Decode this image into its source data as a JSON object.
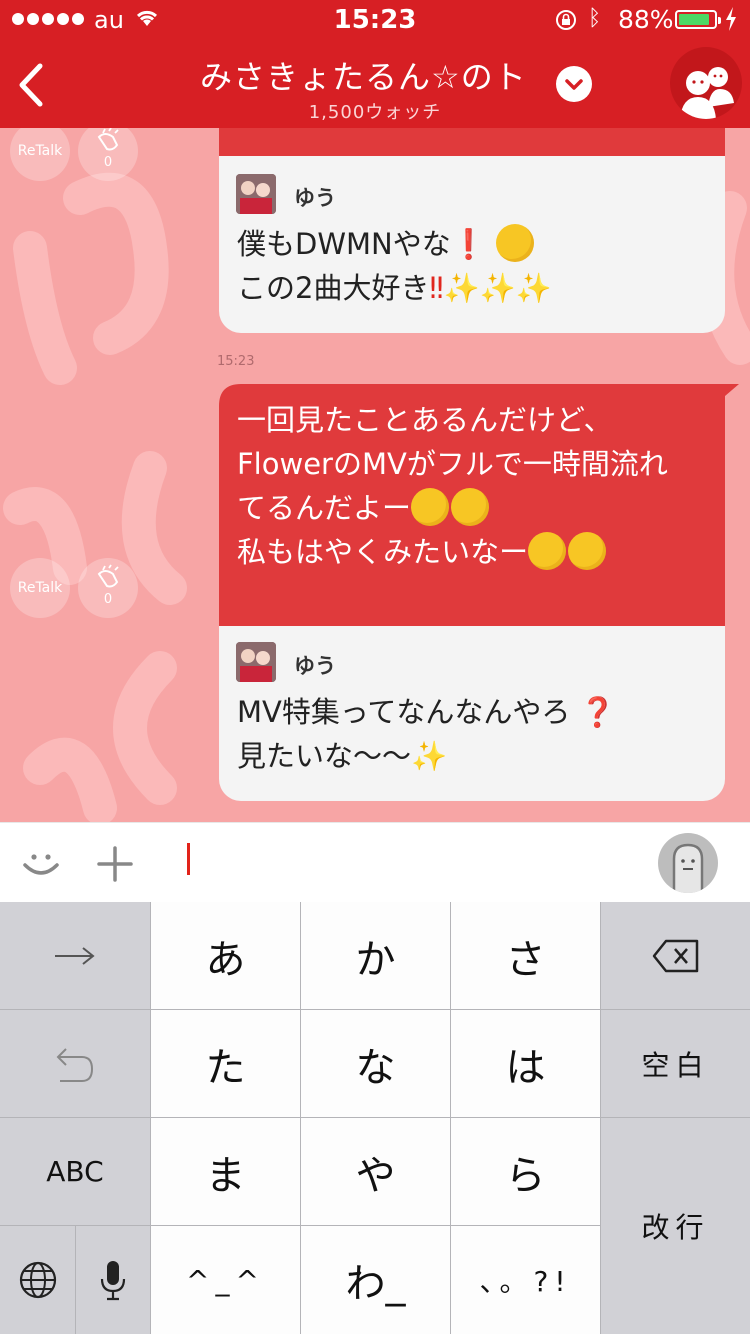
{
  "status_bar": {
    "carrier": "au",
    "time": "15:23",
    "battery_percent": "88%",
    "battery_level": 0.88
  },
  "nav": {
    "title": "みさきょたるん☆のト",
    "watch_count": "1,500ウォッチ"
  },
  "chat": {
    "messages": [
      {
        "type": "quote",
        "user": "ゆう",
        "lines": [
          "僕もDWMNやな",
          "この2曲大好き"
        ],
        "line_emoji": [
          "❗",
          "‼✨✨✨"
        ],
        "retalk_label": "ReTalk",
        "clap_count": "0"
      },
      {
        "time": "15:23",
        "type": "post",
        "lines": [
          "一回見たことあるんだけど、",
          "FlowerのMVがフルで一時間流れ",
          "てるんだよー",
          "私もはやくみたいなー"
        ],
        "retalk_label": "ReTalk",
        "clap_count": "0",
        "quote": {
          "user": "ゆう",
          "lines": [
            "MV特集ってなんなんやろ",
            "見たいな〜〜"
          ],
          "line_emoji": [
            "❓",
            "✨"
          ]
        }
      }
    ]
  },
  "keyboard": {
    "keys": {
      "a": "あ",
      "ka": "か",
      "sa": "さ",
      "ta": "た",
      "na": "な",
      "ha": "は",
      "ma": "ま",
      "ya": "や",
      "ra": "ら",
      "face": "^_^",
      "wa": "わ_",
      "punct": "、。?!",
      "abc": "ABC",
      "space": "空白",
      "return": "改行"
    }
  },
  "colors": {
    "header_red": "#d71f24",
    "chat_bg": "#f7a5a5",
    "bubble_red": "#e03a3c",
    "bubble_white": "#f4f4f4"
  }
}
